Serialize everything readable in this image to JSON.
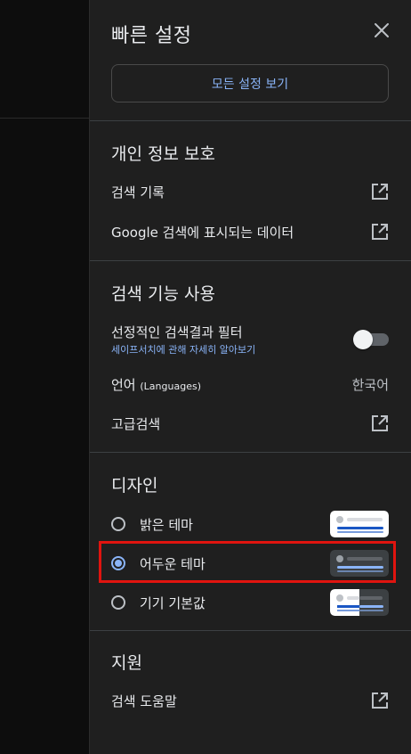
{
  "panel": {
    "title": "빠른 설정",
    "all_settings_label": "모든 설정 보기"
  },
  "privacy": {
    "title": "개인 정보 보호",
    "items": [
      {
        "label": "검색 기록",
        "icon": "open-in-new-icon"
      },
      {
        "label": "Google 검색에 표시되는 데이터",
        "icon": "open-in-new-icon"
      }
    ]
  },
  "search_features": {
    "title": "검색 기능 사용",
    "safe_filter": {
      "label": "선정적인 검색결과 필터",
      "link": "세이프서치에 관해 자세히 알아보기",
      "enabled": false
    },
    "language": {
      "label": "언어",
      "label_sub": "(Languages)",
      "value": "한국어"
    },
    "advanced": {
      "label": "고급검색",
      "icon": "open-in-new-icon"
    }
  },
  "design": {
    "title": "디자인",
    "themes": [
      {
        "label": "밝은 테마",
        "selected": false
      },
      {
        "label": "어두운 테마",
        "selected": true
      },
      {
        "label": "기기 기본값",
        "selected": false
      }
    ]
  },
  "support": {
    "title": "지원",
    "items": [
      {
        "label": "검색 도움말",
        "icon": "open-in-new-icon"
      }
    ]
  },
  "colors": {
    "panel_bg": "#1f1f1f",
    "accent": "#8ab4f8",
    "highlight": "#e0140f"
  }
}
